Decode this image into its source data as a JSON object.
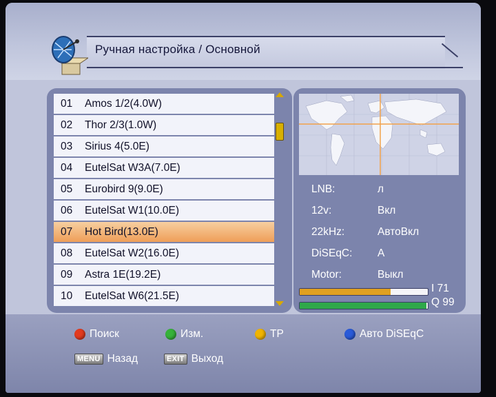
{
  "header": {
    "title": "Ручная настройка / Основной",
    "icon": "satellite-dish-icon"
  },
  "satellites": [
    {
      "num": "01",
      "name": "Amos 1/2(4.0W)"
    },
    {
      "num": "02",
      "name": "Thor 2/3(1.0W)"
    },
    {
      "num": "03",
      "name": "Sirius 4(5.0E)"
    },
    {
      "num": "04",
      "name": "EutelSat W3A(7.0E)"
    },
    {
      "num": "05",
      "name": "Eurobird 9(9.0E)"
    },
    {
      "num": "06",
      "name": "EutelSat W1(10.0E)"
    },
    {
      "num": "07",
      "name": "Hot Bird(13.0E)"
    },
    {
      "num": "08",
      "name": "EutelSat W2(16.0E)"
    },
    {
      "num": "09",
      "name": "Astra 1E(19.2E)"
    },
    {
      "num": "10",
      "name": "EutelSat W6(21.5E)"
    }
  ],
  "selected_index": 6,
  "info": {
    "lnb_label": "LNB:",
    "lnb_value": "л",
    "v12_label": "12v:",
    "v12_value": "Вкл",
    "k22_label": "22kHz:",
    "k22_value": "АвтоВкл",
    "diseqc_label": "DiSEqC:",
    "diseqc_value": "A",
    "motor_label": "Motor:",
    "motor_value": "Выкл"
  },
  "signal": {
    "intensity_label": "I 71",
    "intensity_percent": 71,
    "quality_label": "Q 99",
    "quality_percent": 99,
    "intensity_color": "#e0a020",
    "quality_color": "#2fa84a"
  },
  "footer": {
    "red_label": "Поиск",
    "green_label": "Изм.",
    "yellow_label": "TP",
    "blue_label": "Авто DiSEqC",
    "menu_tag": "MENU",
    "menu_label": "Назад",
    "exit_tag": "EXIT",
    "exit_label": "Выход"
  },
  "colors": {
    "red": "#e23a1e",
    "green": "#36b23a",
    "yellow": "#f0b400",
    "blue": "#2a5ad8",
    "selection": "#ef9e58"
  }
}
